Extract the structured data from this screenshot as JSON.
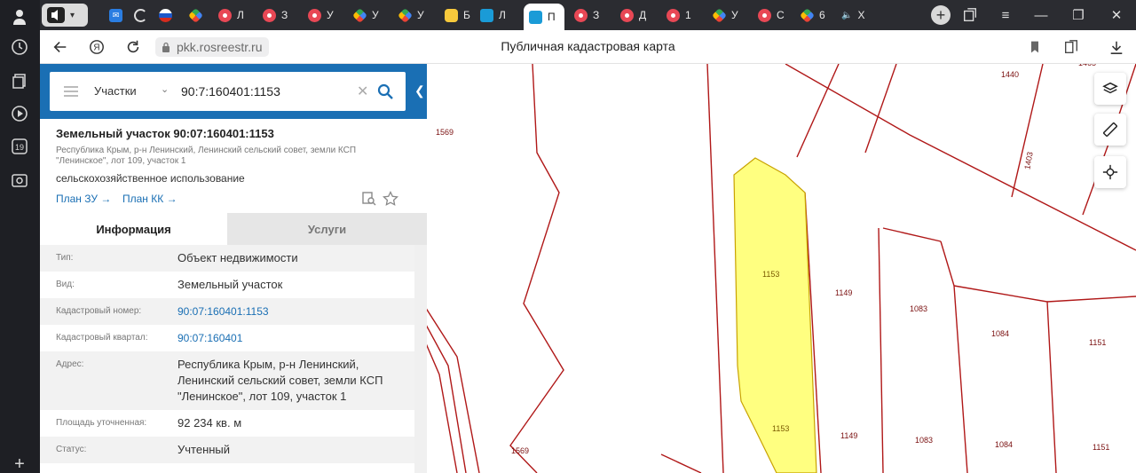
{
  "browser": {
    "tabs": [
      {
        "fav": "red",
        "label": "Л"
      },
      {
        "fav": "red",
        "label": "З"
      },
      {
        "fav": "red",
        "label": "У"
      },
      {
        "fav": "multi",
        "label": "У"
      },
      {
        "fav": "multi",
        "label": "У"
      },
      {
        "fav": "yel",
        "label": "Б"
      },
      {
        "fav": "ros",
        "label": "Л"
      },
      {
        "fav": "ros",
        "label": "П"
      },
      {
        "fav": "red",
        "label": "З"
      },
      {
        "fav": "red",
        "label": "Д"
      },
      {
        "fav": "red",
        "label": "1"
      },
      {
        "fav": "multi",
        "label": "У"
      },
      {
        "fav": "red",
        "label": "С"
      },
      {
        "fav": "multi",
        "label": "6"
      },
      {
        "fav": "audio",
        "label": "Х"
      }
    ],
    "url": "pkk.rosreestr.ru",
    "page_title": "Публичная кадастровая карта",
    "sidebar_badge": "19"
  },
  "search": {
    "type_label": "Участки",
    "query": "90:7:160401:1153"
  },
  "object": {
    "title": "Земельный участок 90:07:160401:1153",
    "address_short": "Республика Крым, р-н Ленинский, Ленинский сельский совет, земли КСП \"Ленинское\", лот 109, участок 1",
    "usage": "сельскохозяйственное использование",
    "link_plan_zu": "План ЗУ →",
    "link_plan_kk": "План КК →"
  },
  "panel_tabs": {
    "info": "Информация",
    "services": "Услуги"
  },
  "info_rows": [
    {
      "key": "Тип:",
      "value": "Объект недвижимости",
      "link": false
    },
    {
      "key": "Вид:",
      "value": "Земельный участок",
      "link": false
    },
    {
      "key": "Кадастровый номер:",
      "value": "90:07:160401:1153",
      "link": true
    },
    {
      "key": "Кадастровый квартал:",
      "value": "90:07:160401",
      "link": true
    },
    {
      "key": "Адрес:",
      "value": "Республика Крым, р-н Ленинский, Ленинский сельский совет, земли КСП \"Ленинское\", лот 109, участок 1",
      "link": false
    },
    {
      "key": "Площадь уточненная:",
      "value": "92 234 кв. м",
      "link": false
    },
    {
      "key": "Статус:",
      "value": "Учтенный",
      "link": false
    }
  ],
  "map_labels": {
    "l1569a": "1569",
    "l1569b": "1569",
    "l1440": "1440",
    "l1403": "1403",
    "l1465": "1465",
    "l1153a": "1153",
    "l1153b": "1153",
    "l1149a": "1149",
    "l1149b": "1149",
    "l1083a": "1083",
    "l1083b": "1083",
    "l1084a": "1084",
    "l1084b": "1084",
    "l1151a": "1151",
    "l1151b": "1151"
  },
  "colors": {
    "brand": "#1a6fb4",
    "parcel_line": "#b01818",
    "selected_fill": "#ffff80"
  }
}
